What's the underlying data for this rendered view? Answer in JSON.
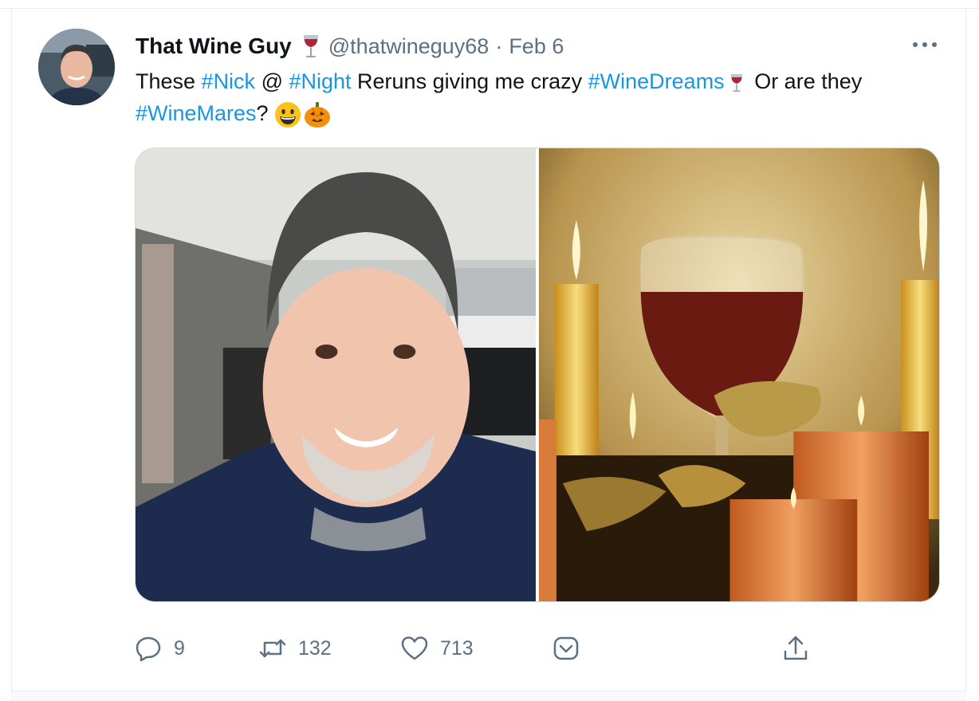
{
  "tweet": {
    "author_name": "That Wine Guy",
    "author_emoji": "wine-glass-icon",
    "handle": "@thatwineguy68",
    "separator": "·",
    "date": "Feb 6",
    "text_parts": {
      "p1": "These ",
      "h1": "#Nick",
      "p2": " @ ",
      "h2": "#Night",
      "p3": " Reruns giving me crazy ",
      "h3": "#WineDreams",
      "p4": " Or are they ",
      "h4": "#WineMares",
      "p5": "? "
    },
    "emojis": [
      "grinning-face-icon",
      "jack-o-lantern-icon"
    ],
    "media": [
      "selfie-photo",
      "wine-candles-photo"
    ],
    "reply_count": "9",
    "retweet_count": "132",
    "like_count": "713"
  },
  "colors": {
    "hashtag": "#1b95e0",
    "secondary_text": "#5b7083",
    "border": "#e6ecf0"
  }
}
